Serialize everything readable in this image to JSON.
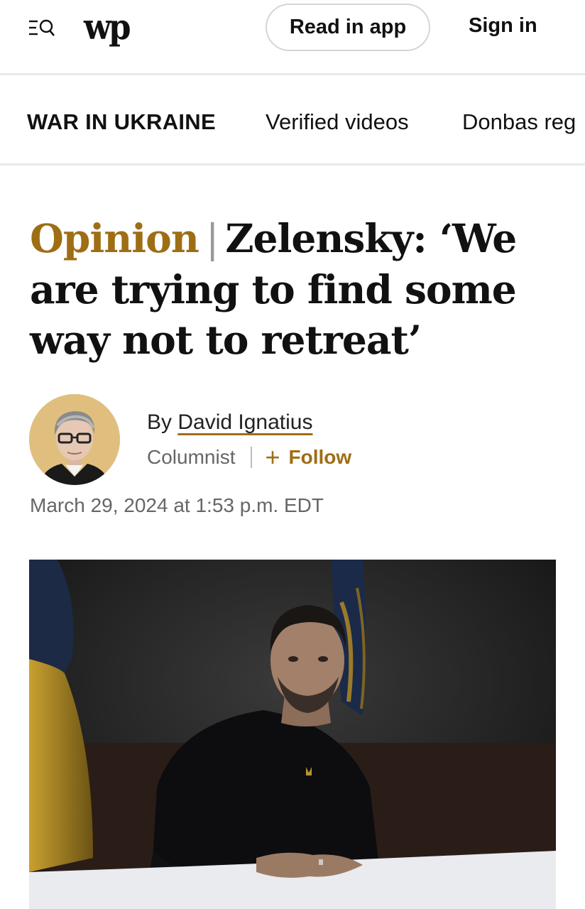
{
  "header": {
    "logo_text": "wp",
    "read_in_app": "Read in app",
    "sign_in": "Sign in"
  },
  "section_nav": {
    "title": "WAR IN UKRAINE",
    "items": [
      "Verified videos",
      "Donbas reg"
    ]
  },
  "article": {
    "kicker": "Opinion",
    "separator": "|",
    "headline": "Zelensky: ‘We are trying to find some way not to retreat’",
    "byline_prefix": "By",
    "author": "David Ignatius",
    "role": "Columnist",
    "follow_label": "Follow",
    "timestamp": "March 29, 2024 at 1:53 p.m. EDT"
  },
  "colors": {
    "accent_gold": "#9e6e15",
    "avatar_bg": "#e0bf7e",
    "divider": "#e9e9e9"
  },
  "icons": {
    "menu": "menu-search-icon",
    "plus": "plus-icon"
  }
}
